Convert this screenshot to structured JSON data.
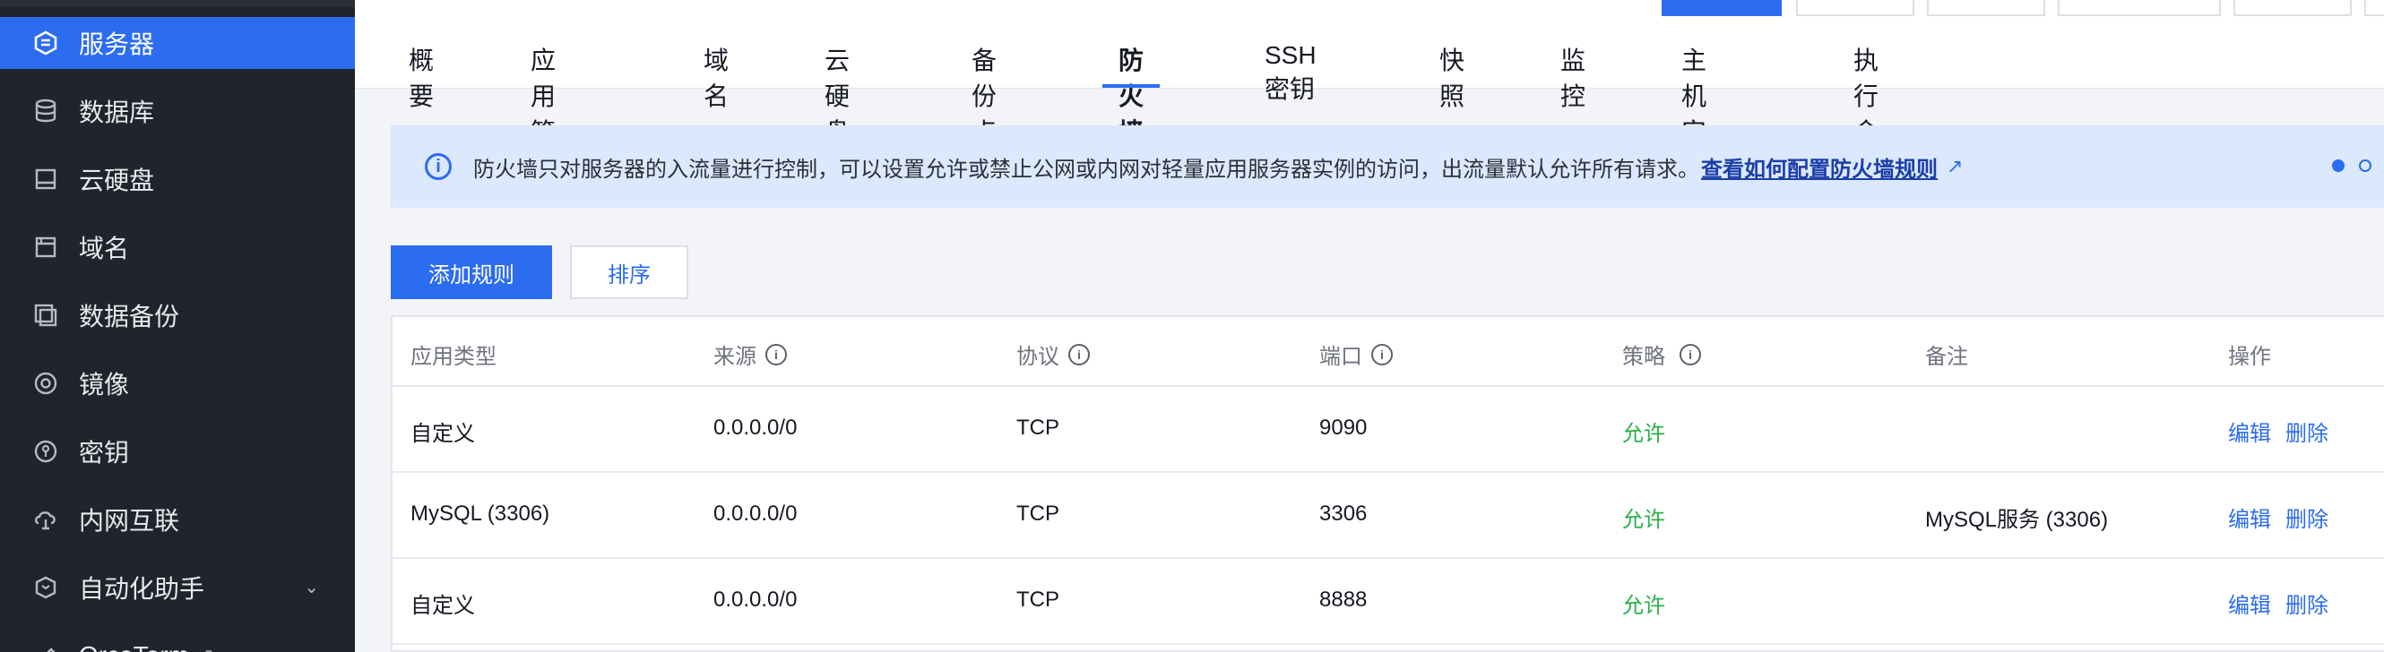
{
  "sidebar": {
    "items": [
      {
        "label": "服务器",
        "icon": "server-icon",
        "active": true
      },
      {
        "label": "数据库",
        "icon": "database-icon"
      },
      {
        "label": "云硬盘",
        "icon": "disk-icon"
      },
      {
        "label": "域名",
        "icon": "domain-icon"
      },
      {
        "label": "数据备份",
        "icon": "backup-icon"
      },
      {
        "label": "镜像",
        "icon": "image-icon"
      },
      {
        "label": "密钥",
        "icon": "key-icon"
      },
      {
        "label": "内网互联",
        "icon": "network-icon"
      },
      {
        "label": "自动化助手",
        "icon": "automation-icon",
        "expandable": true
      },
      {
        "label": "OrcaTerm",
        "icon": "terminal-icon",
        "external": true
      }
    ]
  },
  "tabs": [
    "概要",
    "应用管理",
    "域名",
    "云硬盘",
    "备份点",
    "防火墙",
    "SSH密钥",
    "快照",
    "监控",
    "主机安全",
    "执行命令"
  ],
  "active_tab": "防火墙",
  "notice": {
    "text": "防火墙只对服务器的入流量进行控制，可以设置允许或禁止公网或内网对轻量应用服务器实例的访问，出流量默认允许所有请求。",
    "link": "查看如何配置防火墙规则"
  },
  "buttons": {
    "add_rule": "添加规则",
    "sort": "排序"
  },
  "table": {
    "headers": [
      "应用类型",
      "来源",
      "协议",
      "端口",
      "策略",
      "备注",
      "操作"
    ],
    "rows": [
      {
        "app": "自定义",
        "source": "0.0.0.0/0",
        "protocol": "TCP",
        "port": "9090",
        "policy": "允许",
        "remark": "",
        "edit": "编辑",
        "delete": "删除"
      },
      {
        "app": "MySQL (3306)",
        "source": "0.0.0.0/0",
        "protocol": "TCP",
        "port": "3306",
        "policy": "允许",
        "remark": "MySQL服务 (3306)",
        "edit": "编辑",
        "delete": "删除"
      },
      {
        "app": "自定义",
        "source": "0.0.0.0/0",
        "protocol": "TCP",
        "port": "8888",
        "policy": "允许",
        "remark": "",
        "edit": "编辑",
        "delete": "删除"
      }
    ]
  },
  "colors": {
    "accent": "#2b6cf1",
    "sidebar_bg": "#20242d",
    "allow": "#29b14a"
  }
}
